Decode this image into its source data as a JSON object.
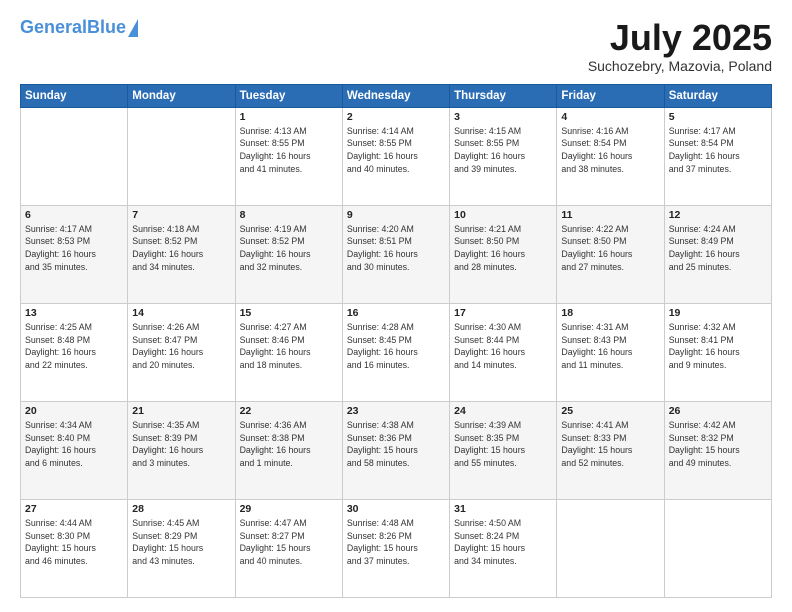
{
  "header": {
    "logo_general": "General",
    "logo_blue": "Blue",
    "month_title": "July 2025",
    "subtitle": "Suchozebry, Mazovia, Poland"
  },
  "days_of_week": [
    "Sunday",
    "Monday",
    "Tuesday",
    "Wednesday",
    "Thursday",
    "Friday",
    "Saturday"
  ],
  "weeks": [
    [
      {
        "day": "",
        "info": ""
      },
      {
        "day": "",
        "info": ""
      },
      {
        "day": "1",
        "info": "Sunrise: 4:13 AM\nSunset: 8:55 PM\nDaylight: 16 hours\nand 41 minutes."
      },
      {
        "day": "2",
        "info": "Sunrise: 4:14 AM\nSunset: 8:55 PM\nDaylight: 16 hours\nand 40 minutes."
      },
      {
        "day": "3",
        "info": "Sunrise: 4:15 AM\nSunset: 8:55 PM\nDaylight: 16 hours\nand 39 minutes."
      },
      {
        "day": "4",
        "info": "Sunrise: 4:16 AM\nSunset: 8:54 PM\nDaylight: 16 hours\nand 38 minutes."
      },
      {
        "day": "5",
        "info": "Sunrise: 4:17 AM\nSunset: 8:54 PM\nDaylight: 16 hours\nand 37 minutes."
      }
    ],
    [
      {
        "day": "6",
        "info": "Sunrise: 4:17 AM\nSunset: 8:53 PM\nDaylight: 16 hours\nand 35 minutes."
      },
      {
        "day": "7",
        "info": "Sunrise: 4:18 AM\nSunset: 8:52 PM\nDaylight: 16 hours\nand 34 minutes."
      },
      {
        "day": "8",
        "info": "Sunrise: 4:19 AM\nSunset: 8:52 PM\nDaylight: 16 hours\nand 32 minutes."
      },
      {
        "day": "9",
        "info": "Sunrise: 4:20 AM\nSunset: 8:51 PM\nDaylight: 16 hours\nand 30 minutes."
      },
      {
        "day": "10",
        "info": "Sunrise: 4:21 AM\nSunset: 8:50 PM\nDaylight: 16 hours\nand 28 minutes."
      },
      {
        "day": "11",
        "info": "Sunrise: 4:22 AM\nSunset: 8:50 PM\nDaylight: 16 hours\nand 27 minutes."
      },
      {
        "day": "12",
        "info": "Sunrise: 4:24 AM\nSunset: 8:49 PM\nDaylight: 16 hours\nand 25 minutes."
      }
    ],
    [
      {
        "day": "13",
        "info": "Sunrise: 4:25 AM\nSunset: 8:48 PM\nDaylight: 16 hours\nand 22 minutes."
      },
      {
        "day": "14",
        "info": "Sunrise: 4:26 AM\nSunset: 8:47 PM\nDaylight: 16 hours\nand 20 minutes."
      },
      {
        "day": "15",
        "info": "Sunrise: 4:27 AM\nSunset: 8:46 PM\nDaylight: 16 hours\nand 18 minutes."
      },
      {
        "day": "16",
        "info": "Sunrise: 4:28 AM\nSunset: 8:45 PM\nDaylight: 16 hours\nand 16 minutes."
      },
      {
        "day": "17",
        "info": "Sunrise: 4:30 AM\nSunset: 8:44 PM\nDaylight: 16 hours\nand 14 minutes."
      },
      {
        "day": "18",
        "info": "Sunrise: 4:31 AM\nSunset: 8:43 PM\nDaylight: 16 hours\nand 11 minutes."
      },
      {
        "day": "19",
        "info": "Sunrise: 4:32 AM\nSunset: 8:41 PM\nDaylight: 16 hours\nand 9 minutes."
      }
    ],
    [
      {
        "day": "20",
        "info": "Sunrise: 4:34 AM\nSunset: 8:40 PM\nDaylight: 16 hours\nand 6 minutes."
      },
      {
        "day": "21",
        "info": "Sunrise: 4:35 AM\nSunset: 8:39 PM\nDaylight: 16 hours\nand 3 minutes."
      },
      {
        "day": "22",
        "info": "Sunrise: 4:36 AM\nSunset: 8:38 PM\nDaylight: 16 hours\nand 1 minute."
      },
      {
        "day": "23",
        "info": "Sunrise: 4:38 AM\nSunset: 8:36 PM\nDaylight: 15 hours\nand 58 minutes."
      },
      {
        "day": "24",
        "info": "Sunrise: 4:39 AM\nSunset: 8:35 PM\nDaylight: 15 hours\nand 55 minutes."
      },
      {
        "day": "25",
        "info": "Sunrise: 4:41 AM\nSunset: 8:33 PM\nDaylight: 15 hours\nand 52 minutes."
      },
      {
        "day": "26",
        "info": "Sunrise: 4:42 AM\nSunset: 8:32 PM\nDaylight: 15 hours\nand 49 minutes."
      }
    ],
    [
      {
        "day": "27",
        "info": "Sunrise: 4:44 AM\nSunset: 8:30 PM\nDaylight: 15 hours\nand 46 minutes."
      },
      {
        "day": "28",
        "info": "Sunrise: 4:45 AM\nSunset: 8:29 PM\nDaylight: 15 hours\nand 43 minutes."
      },
      {
        "day": "29",
        "info": "Sunrise: 4:47 AM\nSunset: 8:27 PM\nDaylight: 15 hours\nand 40 minutes."
      },
      {
        "day": "30",
        "info": "Sunrise: 4:48 AM\nSunset: 8:26 PM\nDaylight: 15 hours\nand 37 minutes."
      },
      {
        "day": "31",
        "info": "Sunrise: 4:50 AM\nSunset: 8:24 PM\nDaylight: 15 hours\nand 34 minutes."
      },
      {
        "day": "",
        "info": ""
      },
      {
        "day": "",
        "info": ""
      }
    ]
  ]
}
